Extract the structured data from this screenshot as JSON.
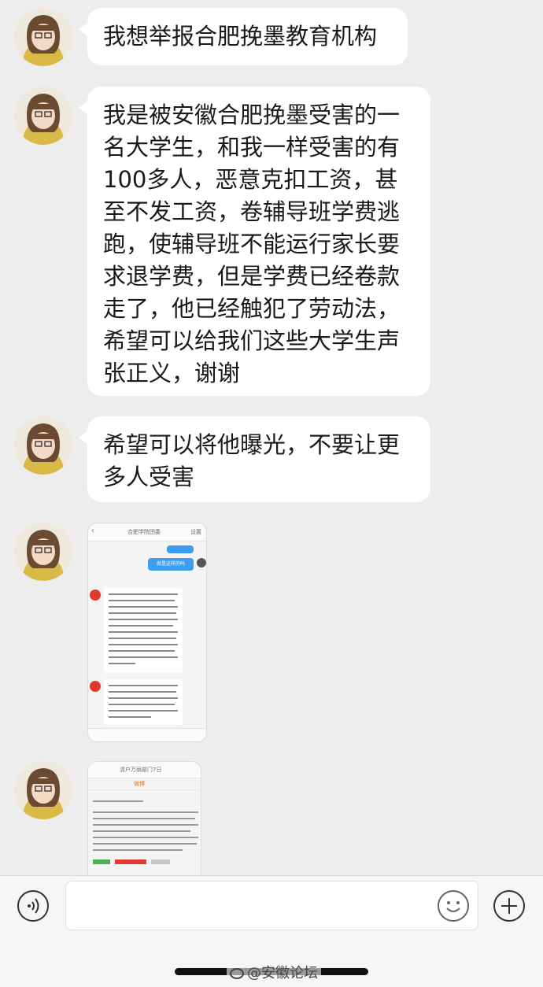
{
  "messages": [
    {
      "text": "我想举报合肥挽墨教育机构"
    },
    {
      "text": "我是被安徽合肥挽墨受害的一名大学生，和我一样受害的有100多人，恶意克扣工资，甚至不发工资，卷辅导班学费逃跑，使辅导班不能运行家长要求退学费，但是学费已经卷款走了，他已经触犯了劳动法，希望可以给我们这些大学生声张正义，谢谢"
    },
    {
      "text": "希望可以将他曝光，不要让更多人受害"
    }
  ],
  "screenshot1": {
    "title": "合肥学院团委",
    "action": "设置",
    "sent_text": "就是这样的吗"
  },
  "screenshot2": {
    "title": "清户万丽部门7日",
    "tab": "微博"
  },
  "input_bar": {
    "voice_icon": "voice-icon",
    "emoji_icon": "emoji-icon",
    "add_icon": "plus-icon"
  },
  "watermark": "@安徽论坛"
}
